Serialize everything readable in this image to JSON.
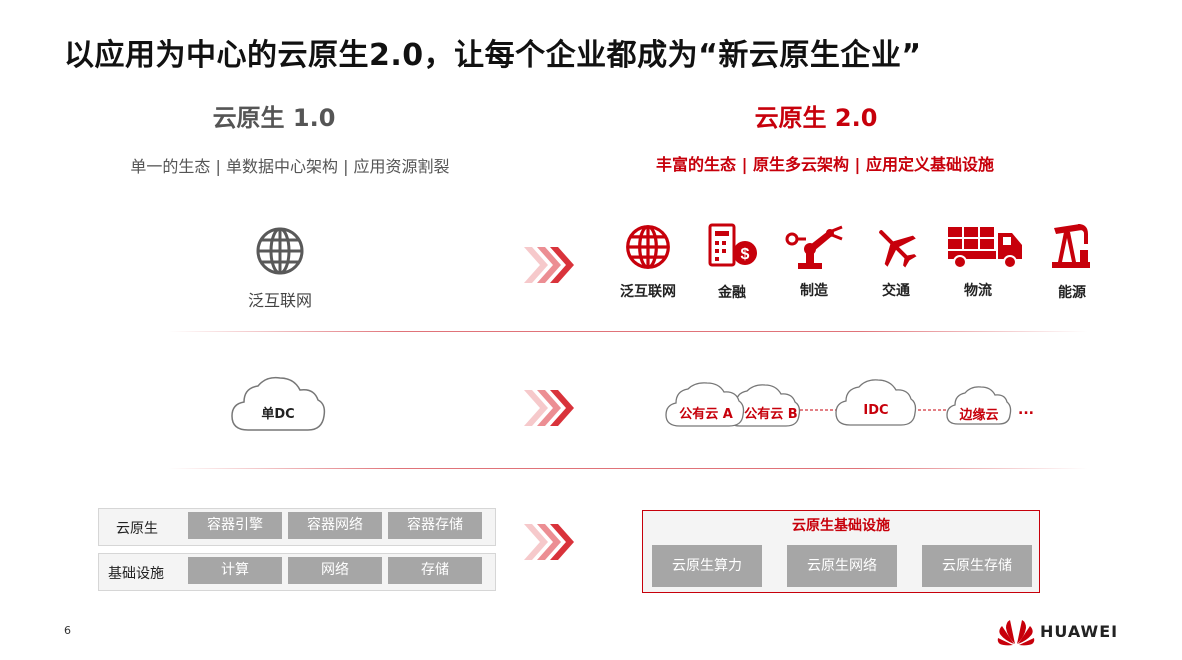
{
  "slide": {
    "title": "以应用为中心的云原生2.0，让每个企业都成为“新云原生企业”",
    "page_number": "6"
  },
  "left": {
    "heading": "云原生 1.0",
    "subtitle": "单一的生态 | 单数据中心架构 | 应用资源割裂",
    "ecosystem_label": "泛互联网",
    "dc_label": "单DC",
    "rows": [
      {
        "label": "云原生",
        "items": [
          "容器引擎",
          "容器网络",
          "容器存储"
        ]
      },
      {
        "label": "基础设施",
        "items": [
          "计算",
          "网络",
          "存储"
        ]
      }
    ]
  },
  "right": {
    "heading": "云原生 2.0",
    "subtitle": "丰富的生态 | 原生多云架构 | 应用定义基础设施",
    "industries": [
      {
        "label": "泛互联网",
        "icon": "globe-icon"
      },
      {
        "label": "金融",
        "icon": "finance-icon"
      },
      {
        "label": "制造",
        "icon": "robot-arm-icon"
      },
      {
        "label": "交通",
        "icon": "airplane-icon"
      },
      {
        "label": "物流",
        "icon": "truck-icon"
      },
      {
        "label": "能源",
        "icon": "oil-pump-icon"
      }
    ],
    "clouds": {
      "public_a": "公有云 A",
      "public_b": "公有云 B",
      "idc": "IDC",
      "edge": "边缘云",
      "more": "..."
    },
    "infra": {
      "title": "云原生基础设施",
      "items": [
        "云原生算力",
        "云原生网络",
        "云原生存储"
      ]
    }
  },
  "brand": {
    "name": "HUAWEI"
  },
  "colors": {
    "accent": "#c7000b",
    "gray_box": "#a6a6a6",
    "icon_gray": "#595959"
  }
}
